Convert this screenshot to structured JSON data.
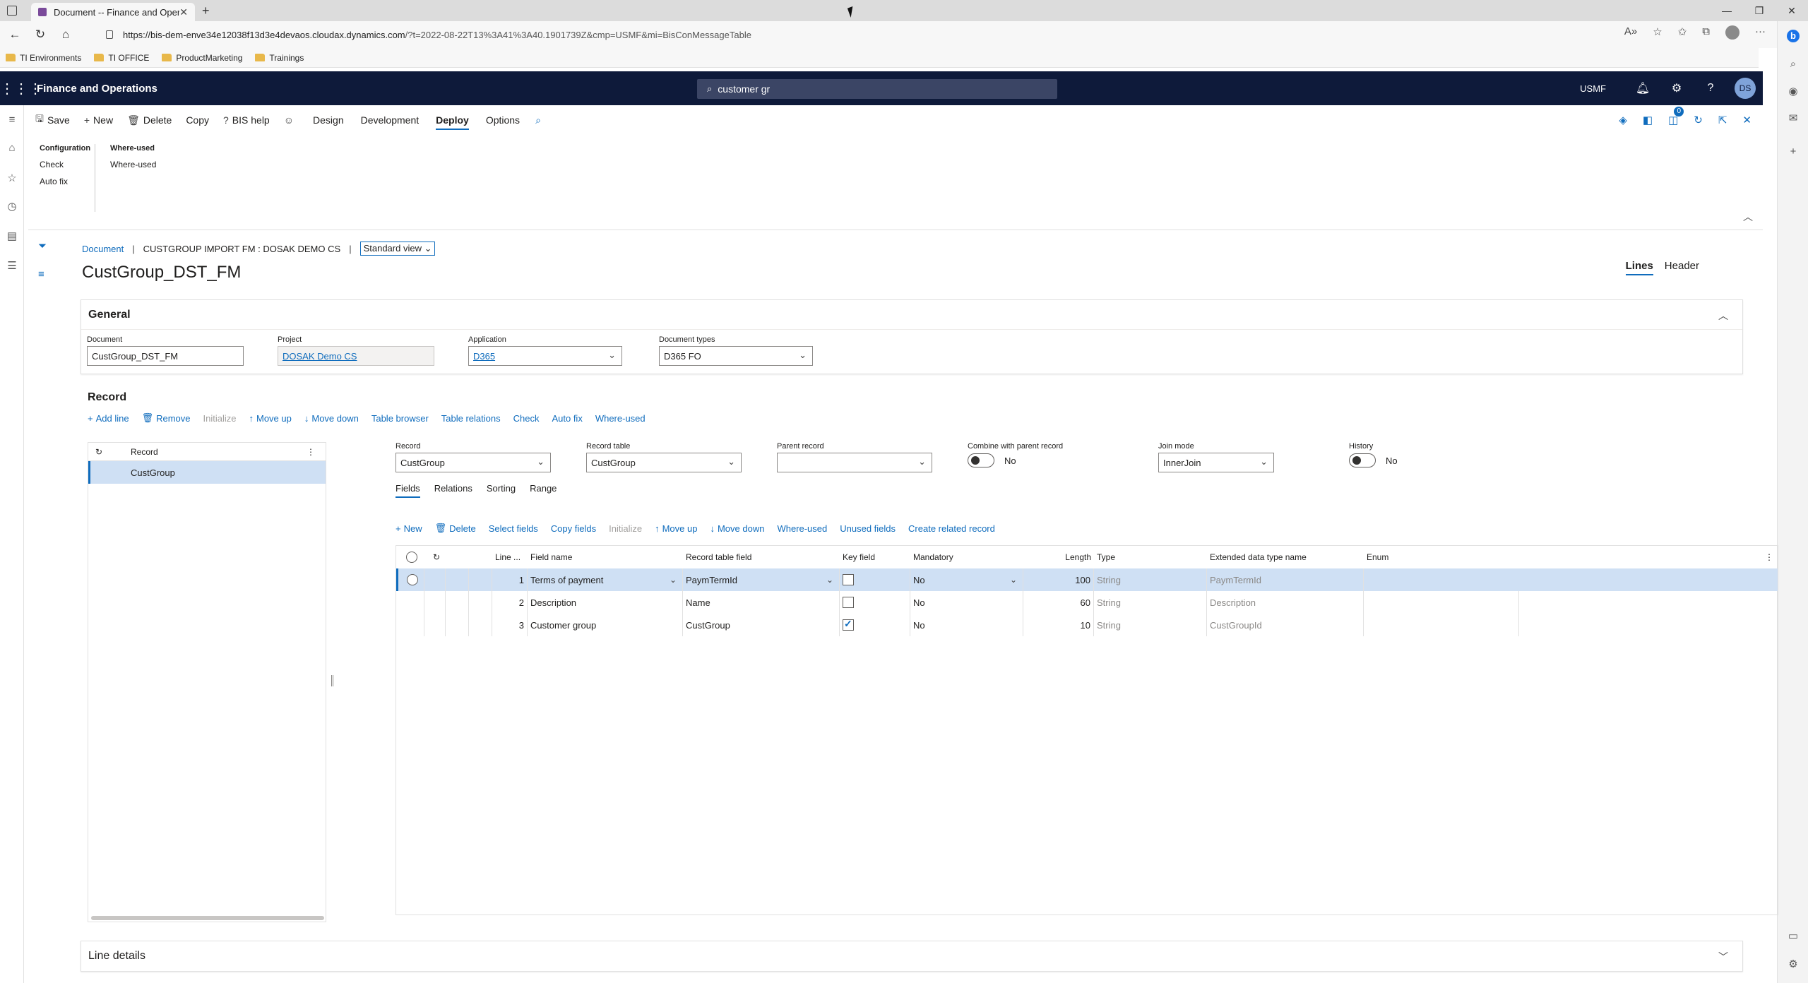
{
  "browser": {
    "tab_title": "Document -- Finance and Opera",
    "url_host": "https://bis-dem-enve34e12038f13d3e4devaos.cloudax.dynamics.com",
    "url_rest": "/?t=2022-08-22T13%3A41%3A40.1901739Z&cmp=USMF&mi=BisConMessageTable",
    "bookmarks": [
      "TI Environments",
      "TI OFFICE",
      "ProductMarketing",
      "Trainings"
    ]
  },
  "topbar": {
    "app_name": "Finance and Operations",
    "search_value": "customer gr",
    "company": "USMF",
    "avatar_initials": "DS"
  },
  "actionpane": {
    "save": "Save",
    "new": "New",
    "delete": "Delete",
    "copy": "Copy",
    "bis_help": "BIS help",
    "tabs": [
      "Design",
      "Development",
      "Deploy",
      "Options"
    ],
    "active_tab": "Deploy",
    "badge_count": "0"
  },
  "ribbon": {
    "group1_header": "Configuration",
    "group1_items": [
      "Check",
      "Auto fix"
    ],
    "group2_header": "Where-used",
    "group2_items": [
      "Where-used"
    ]
  },
  "page": {
    "breadcrumb_link": "Document",
    "breadcrumb_record": "CUSTGROUP IMPORT FM : DOSAK DEMO CS",
    "view": "Standard view",
    "title": "CustGroup_DST_FM",
    "tab_lines": "Lines",
    "tab_header": "Header"
  },
  "general": {
    "header": "General",
    "document_label": "Document",
    "document_value": "CustGroup_DST_FM",
    "project_label": "Project",
    "project_value": "DOSAK Demo CS",
    "application_label": "Application",
    "application_value": "D365",
    "doctypes_label": "Document types",
    "doctypes_value": "D365 FO"
  },
  "record": {
    "header": "Record",
    "toolbar": [
      "Add line",
      "Remove",
      "Initialize",
      "Move up",
      "Move down",
      "Table browser",
      "Table relations",
      "Check",
      "Auto fix",
      "Where-used"
    ],
    "grid_col": "Record",
    "grid_row": "CustGroup",
    "record_label": "Record",
    "record_value": "CustGroup",
    "record_table_label": "Record table",
    "record_table_value": "CustGroup",
    "parent_label": "Parent record",
    "parent_value": "",
    "combine_label": "Combine with parent record",
    "combine_value": "No",
    "joinmode_label": "Join mode",
    "joinmode_value": "InnerJoin",
    "history_label": "History",
    "history_value": "No",
    "subtabs": [
      "Fields",
      "Relations",
      "Sorting",
      "Range"
    ]
  },
  "fields": {
    "toolbar": [
      "New",
      "Delete",
      "Select fields",
      "Copy fields",
      "Initialize",
      "Move up",
      "Move down",
      "Where-used",
      "Unused fields",
      "Create related record"
    ],
    "columns": {
      "line": "Line ...",
      "field_name": "Field name",
      "record_table_field": "Record table field",
      "key_field": "Key field",
      "mandatory": "Mandatory",
      "length": "Length",
      "type": "Type",
      "edt": "Extended data type name",
      "enum": "Enum"
    },
    "rows": [
      {
        "line": "1",
        "field_name": "Terms of payment",
        "rtf": "PaymTermId",
        "key": false,
        "mandatory": "No",
        "length": "100",
        "type": "String",
        "edt": "PaymTermId"
      },
      {
        "line": "2",
        "field_name": "Description",
        "rtf": "Name",
        "key": false,
        "mandatory": "No",
        "length": "60",
        "type": "String",
        "edt": "Description"
      },
      {
        "line": "3",
        "field_name": "Customer group",
        "rtf": "CustGroup",
        "key": true,
        "mandatory": "No",
        "length": "10",
        "type": "String",
        "edt": "CustGroupId"
      }
    ]
  },
  "line_details": {
    "header": "Line details"
  }
}
